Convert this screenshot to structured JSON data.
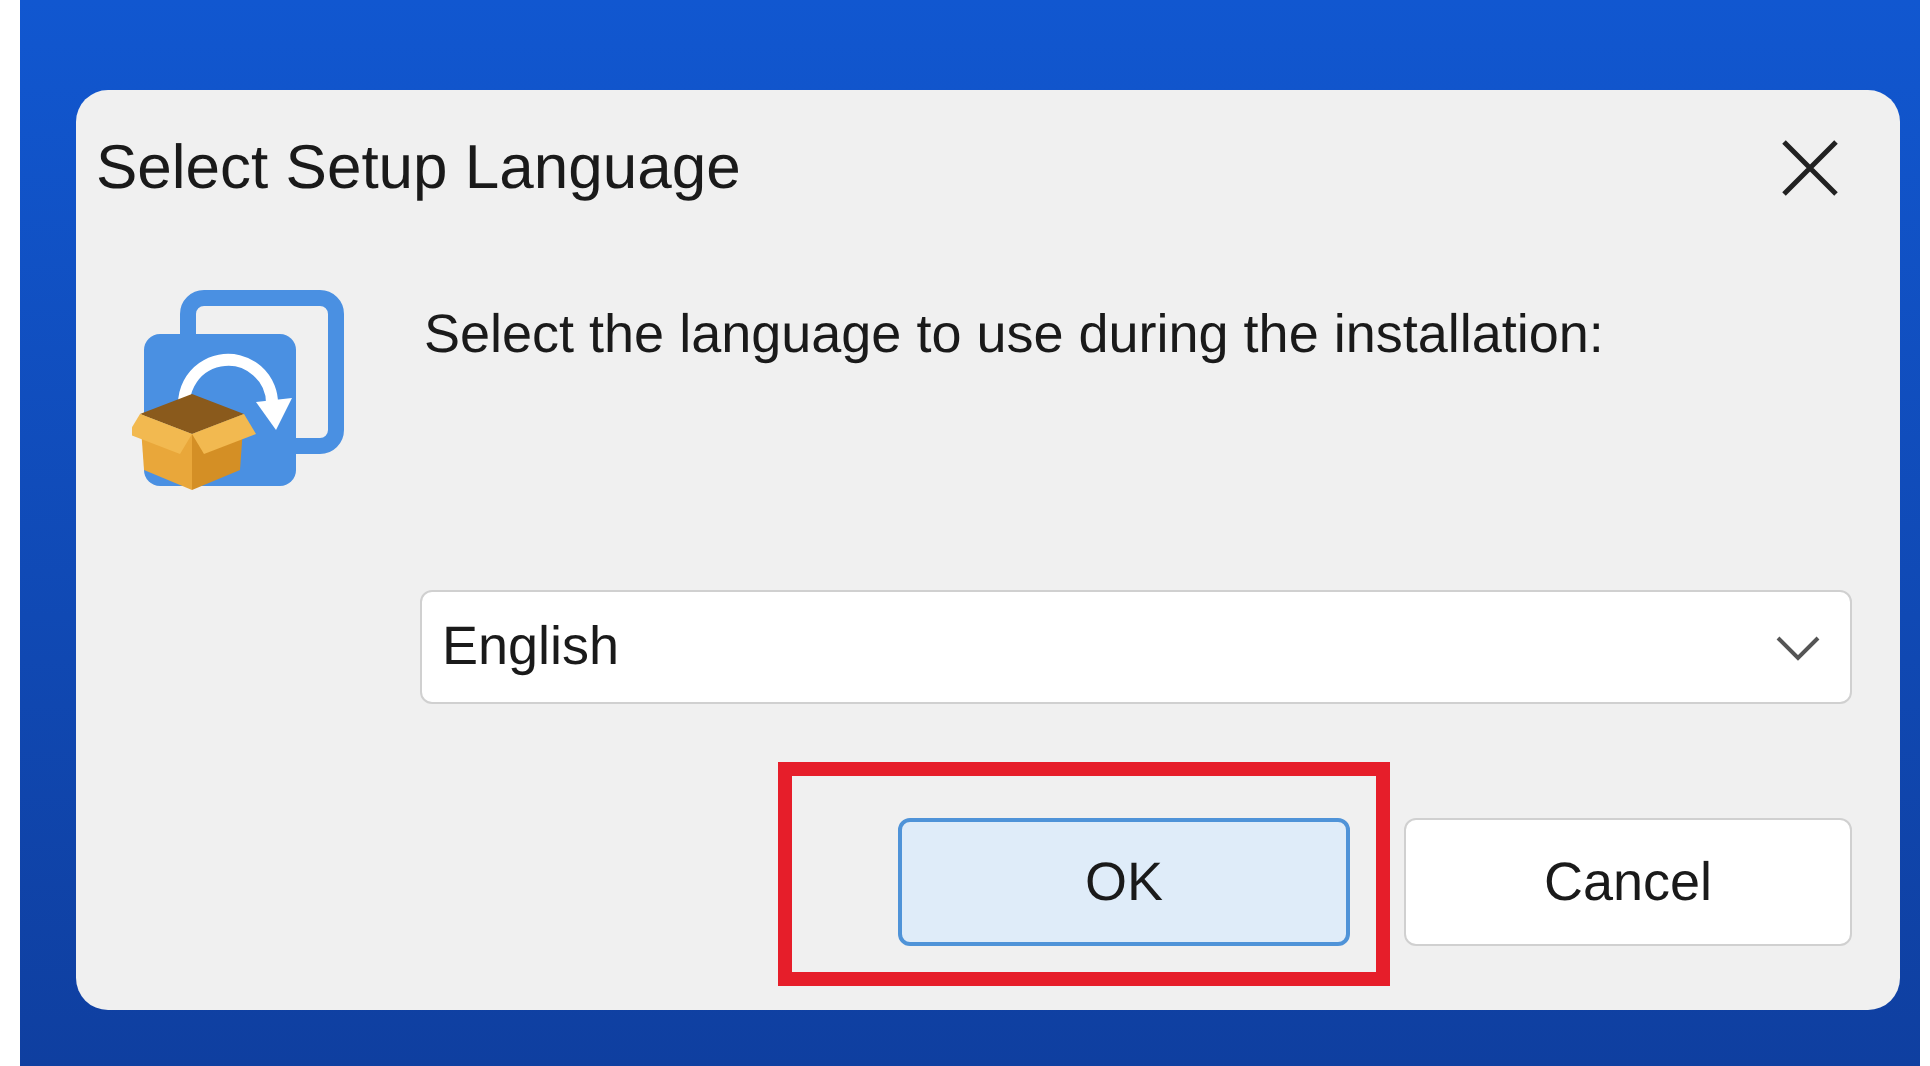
{
  "window": {
    "title": "Select Setup Language"
  },
  "message": "Select the language to use during the installation:",
  "language_select": {
    "value": "English"
  },
  "buttons": [
    {
      "label": "OK",
      "selected": true,
      "highlighted": true
    },
    {
      "label": "Cancel",
      "selected": false,
      "highlighted": false
    }
  ]
}
